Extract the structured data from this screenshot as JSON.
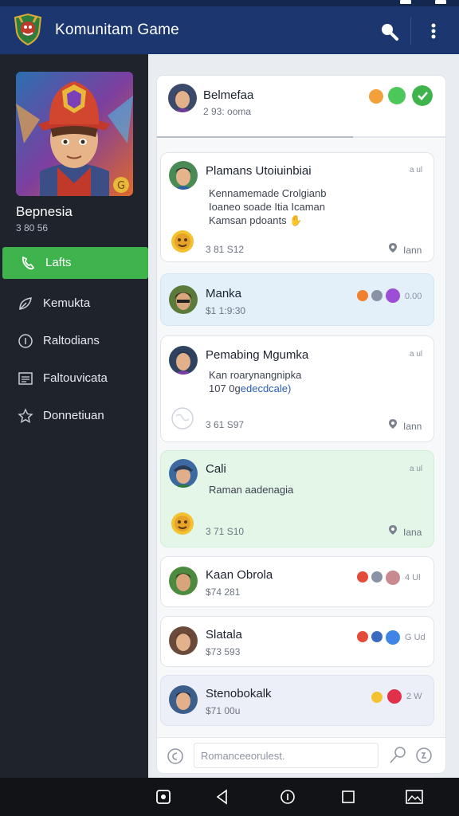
{
  "app": {
    "title": "Komunitam Game",
    "brand_color": "#1c3770",
    "accent": "#3fb44c"
  },
  "appbar": {
    "icons": [
      "search-icon",
      "more-vert-icon"
    ]
  },
  "profile": {
    "name": "Bepnesia",
    "sub": "3 80 56"
  },
  "sidebar": {
    "items": [
      {
        "label": "Lafts",
        "icon": "phone-icon",
        "active": true
      },
      {
        "label": "Kemukta",
        "icon": "leaf-icon",
        "active": false
      },
      {
        "label": "Raltodians",
        "icon": "info-circle-icon",
        "active": false
      },
      {
        "label": "Faltouvicata",
        "icon": "list-icon",
        "active": false
      },
      {
        "label": "Donnetiuan",
        "icon": "star-icon",
        "active": false
      }
    ]
  },
  "pinned": {
    "title": "Belmefaa",
    "sub": "2 93: ooma",
    "progress": 0.68
  },
  "posts": [
    {
      "title": "Plamans Utoiuinbiai",
      "corner": "a ul",
      "body1": "Kennamemade Crolgianb",
      "body2": "Ioaneo soade Itia Icaman",
      "body3": "Kamsan pdoants",
      "meta": "3 81 S12",
      "action": "Iann",
      "variant": "white"
    },
    {
      "title": "Manka",
      "sub": "$1 1:9:30",
      "corner": "0.00",
      "variant": "blue"
    },
    {
      "title": "Pemabing Mgumka",
      "corner": "a ul",
      "body1": "Kan roarynangnipka",
      "body2_plain": "107 0g",
      "body2_link": "edecdcale)",
      "meta": "3 61 S97",
      "action": "Iann",
      "variant": "white"
    },
    {
      "title": "Cali",
      "corner": "a ul",
      "body1": "Raman aadenagia",
      "meta": "3 71 S10",
      "action": "Iana",
      "variant": "green"
    },
    {
      "title": "Kaan Obrola",
      "sub": "$74 281",
      "corner": "4 Ul",
      "variant": "white"
    },
    {
      "title": "Slatala",
      "sub": "$73 593",
      "corner": "G Ud",
      "variant": "white"
    },
    {
      "title": "Stenobokalk",
      "sub": "$71 00u",
      "corner": "2 W",
      "variant": "lavender"
    }
  ],
  "composer": {
    "placeholder": "Romanceeorulest."
  },
  "bottomnav": {
    "icons": [
      "recent-square-icon",
      "back-triangle-icon",
      "home-circle-icon",
      "overview-square-icon",
      "gallery-icon"
    ]
  }
}
